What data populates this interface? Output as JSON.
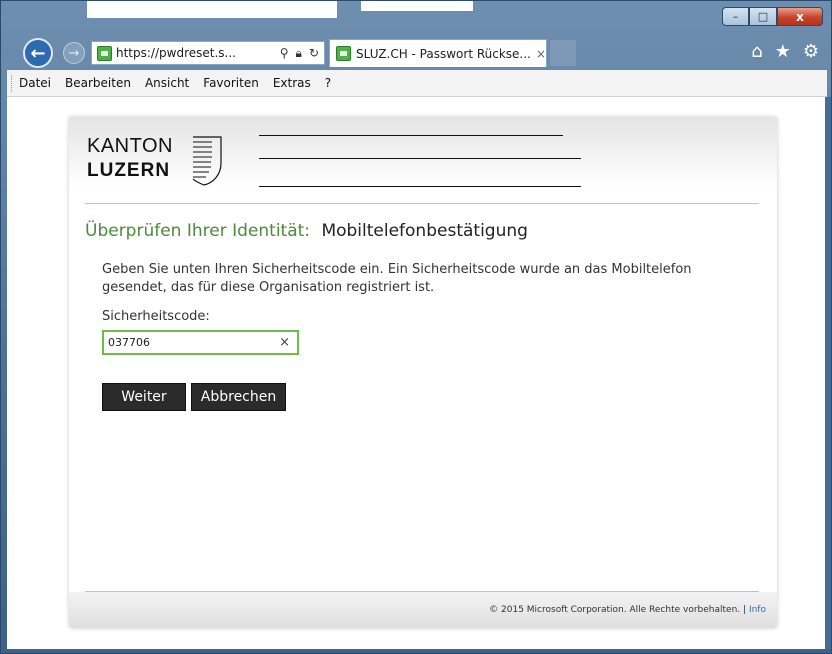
{
  "browser": {
    "address_url": "https://pwdreset.s...",
    "tab_title": "SLUZ.CH - Passwort Rückse...",
    "tab_close": "×",
    "controls": {
      "minimize": "–",
      "maximize": "□",
      "close": "x"
    },
    "icons": [
      "back-arrow-icon",
      "forward-arrow-icon",
      "search-icon",
      "lock-icon",
      "refresh-icon",
      "home-icon",
      "favorites-star-icon",
      "settings-gear-icon"
    ]
  },
  "menu": {
    "items": [
      "Datei",
      "Bearbeiten",
      "Ansicht",
      "Favoriten",
      "Extras",
      "?"
    ]
  },
  "logo": {
    "line1": "KANTON",
    "line2": "LUZERN"
  },
  "page": {
    "heading_prefix": "Überprüfen Ihrer Identität:",
    "heading_main": "Mobiltelefonbestätigung",
    "description": "Geben Sie unten Ihren Sicherheitscode ein. Ein Sicherheitscode wurde an das Mobiltelefon gesendet, das für diese Organisation registriert ist.",
    "code_label": "Sicherheitscode:",
    "code_value": "037706",
    "clear_symbol": "×",
    "btn_next": "Weiter",
    "btn_cancel": "Abbrechen"
  },
  "footer": {
    "copyright": "© 2015 Microsoft Corporation. Alle Rechte vorbehalten.",
    "separator": "|",
    "info_link": "Info"
  },
  "colors": {
    "heading_green": "#4b8b3a",
    "input_border": "#6cbd45",
    "button_bg": "#2b2b2b",
    "link_blue": "#2f6fb3"
  }
}
